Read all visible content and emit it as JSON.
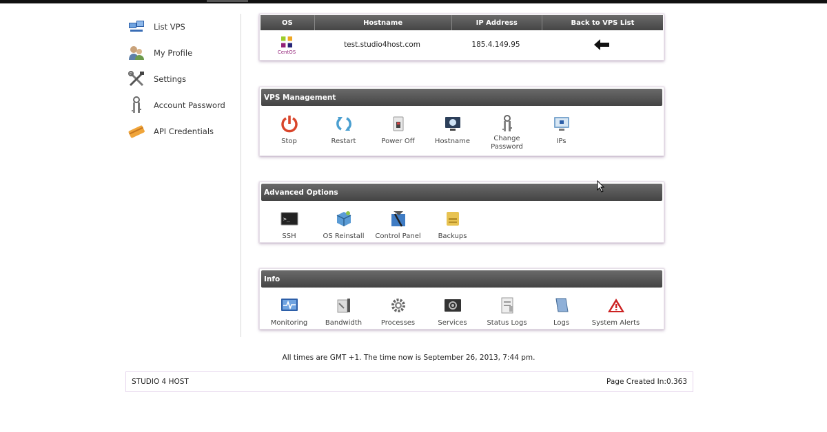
{
  "sidebar": {
    "items": [
      {
        "label": "List VPS",
        "icon": "servers-icon"
      },
      {
        "label": "My Profile",
        "icon": "users-icon"
      },
      {
        "label": "Settings",
        "icon": "tools-icon"
      },
      {
        "label": "Account Password",
        "icon": "keys-icon"
      },
      {
        "label": "API Credentials",
        "icon": "card-icon"
      }
    ]
  },
  "vps": {
    "headers": [
      "OS",
      "Hostname",
      "IP Address",
      "Back to VPS List"
    ],
    "os_label": "CentOS",
    "hostname": "test.studio4host.com",
    "ip": "185.4.149.95"
  },
  "management": {
    "title": "VPS Management",
    "items": [
      "Stop",
      "Restart",
      "Power Off",
      "Hostname",
      "Change Password",
      "IPs"
    ]
  },
  "advanced": {
    "title": "Advanced Options",
    "items": [
      "SSH",
      "OS Reinstall",
      "Control Panel",
      "Backups"
    ]
  },
  "info": {
    "title": "Info",
    "items": [
      "Monitoring",
      "Bandwidth",
      "Processes",
      "Services",
      "Status Logs",
      "Logs",
      "System Alerts"
    ]
  },
  "footer": {
    "time_note": "All times are GMT +1. The time now is September 26, 2013, 7:44 pm.",
    "brand": "STUDIO 4 HOST",
    "page_created": "Page Created In:0.363"
  },
  "colors": {
    "header_bar": "#555555",
    "stop_red": "#d9452b",
    "restart_blue": "#4a9fd0",
    "alert_red": "#cc2222"
  }
}
